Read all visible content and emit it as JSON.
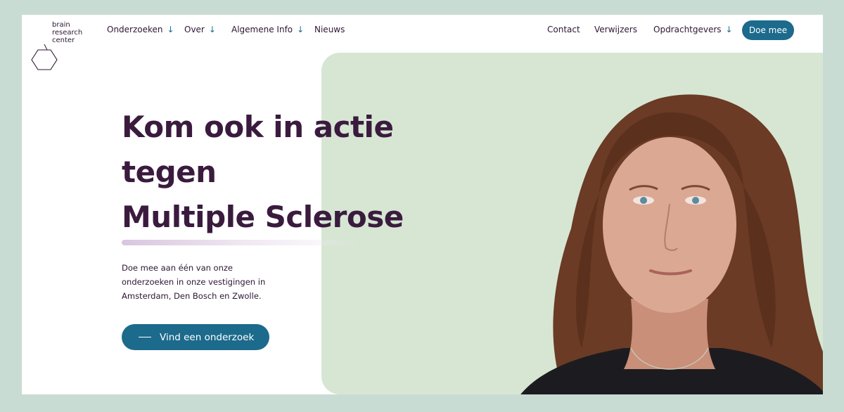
{
  "logo": {
    "line1": "brain",
    "line2": "research",
    "line3": "center"
  },
  "nav_left": [
    {
      "label": "Onderzoeken",
      "arrow": "↓"
    },
    {
      "label": "Over",
      "arrow": "↓"
    },
    {
      "label": "Algemene Info",
      "arrow": "↓"
    },
    {
      "label": "Nieuws"
    }
  ],
  "nav_right": [
    {
      "label": "Contact"
    },
    {
      "label": "Verwijzers"
    },
    {
      "label": "Opdrachtgevers",
      "arrow": "↓"
    }
  ],
  "cta_top": "Doe mee",
  "hero": {
    "headline_line1": "Kom ook in actie",
    "headline_line2": "tegen",
    "headline_line3": "Multiple Sclerose",
    "intro": "Doe mee aan één van onze onderzoeken in onze vestigingen in Amsterdam, Den Bosch en Zwolle.",
    "cta": "Vind een onderzoek"
  },
  "colors": {
    "brand_blue": "#1c6a8c",
    "hero_green": "#d6e6d3",
    "text_purple": "#3a1b3e",
    "page_bg": "#c9dcd3"
  },
  "icons": {
    "logo": "hexagon-logo-icon",
    "arrow": "arrow-down-icon"
  }
}
